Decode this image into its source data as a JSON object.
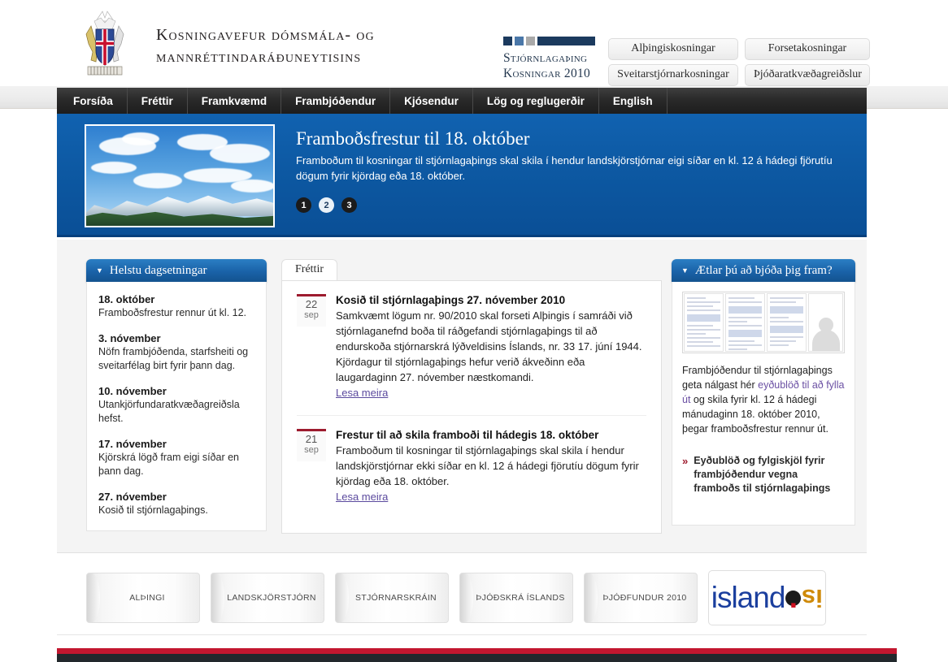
{
  "masthead": {
    "crest_alt": "iceland-coat-of-arms",
    "title_line1": "Kosningavefur dómsmála- og",
    "title_line2": "mannréttindaráðuneytisins",
    "logo": {
      "line1": "Stjórnlagaþing",
      "line2": "Kosningar 2010"
    },
    "buttons": [
      "Alþingiskosningar",
      "Forsetakosningar",
      "Sveitarstjórnarkosningar",
      "Þjóðaratkvæðagreiðslur"
    ]
  },
  "nav": {
    "items": [
      "Forsíða",
      "Fréttir",
      "Framkvæmd",
      "Frambjóðendur",
      "Kjósendur",
      "Lög og reglugerðir",
      "English"
    ]
  },
  "hero": {
    "heading": "Framboðsfrestur til 18. október",
    "paragraph": "Framboðum til kosningar til stjórnlagaþings skal skila í hendur landskjörstjórnar eigi síðar en kl. 12 á hádegi fjörutíu dögum fyrir kjördag eða 18. október.",
    "slides": [
      "1",
      "2",
      "3"
    ],
    "active_slide": "2",
    "image_alt": "iceland-mountain-landscape-photo"
  },
  "dates_panel": {
    "title": "Helstu dagsetningar",
    "items": [
      {
        "date": "18. október",
        "desc": "Framboðsfrestur rennur út kl. 12."
      },
      {
        "date": "3. nóvember",
        "desc": "Nöfn frambjóðenda, starfsheiti og sveitarfélag birt fyrir þann dag."
      },
      {
        "date": "10. nóvember",
        "desc": "Utankjörfundaratkvæðagreiðsla hefst."
      },
      {
        "date": "17. nóvember",
        "desc": "Kjörskrá lögð fram eigi síðar en þann dag."
      },
      {
        "date": "27. nóvember",
        "desc": "Kosið til stjórnlagaþings."
      }
    ]
  },
  "news": {
    "tab_label": "Fréttir",
    "items": [
      {
        "day": "22",
        "month": "sep",
        "headline": "Kosið til stjórnlagaþings 27. nóvember 2010",
        "body": "Samkvæmt lögum nr. 90/2010 skal forseti Alþingis í samráði við stjórnlaganefnd boða til ráðgefandi stjórnlagaþings til að endurskoða stjórnarskrá lýðveldisins Íslands, nr. 33 17. júní 1944. Kjördagur til stjórnlagaþings hefur verið ákveðinn eða laugardaginn 27. nóvember næstkomandi.",
        "more": "Lesa meira"
      },
      {
        "day": "21",
        "month": "sep",
        "headline": "Frestur til að skila framboði til hádegis 18. október",
        "body": "Framboðum til kosningar til stjórnlagaþings skal skila í hendur landskjörstjórnar ekki síðar en kl. 12 á hádegi fjörutíu dögum fyrir kjördag eða 18. október.",
        "more": "Lesa meira"
      }
    ]
  },
  "offer_panel": {
    "title": "Ætlar þú að bjóða þig fram?",
    "thumb_alt": "candidacy-forms-thumbnail",
    "text_before": "Frambjóðendur til stjórnlagaþings geta nálgast hér ",
    "link_text": "eyðublöð til að fylla út",
    "text_after": " og skila fyrir kl. 12 á hádegi mánudaginn 18. október 2010, þegar framboðsfrestur rennur út.",
    "bullet_marker": "»",
    "bullet_link": "Eyðublöð og fylgiskjöl fyrir frambjóðendur vegna framboðs til stjórnlagaþings"
  },
  "partners": {
    "items": [
      "ALÞINGI",
      "LANDSKJÖRSTJÓRN",
      "STJÓRNARSKRÁIN",
      "ÞJÓÐSKRÁ ÍSLANDS",
      "ÞJÓÐFUNDUR 2010"
    ],
    "island_logo": {
      "name": "island",
      "dot": ".",
      "suffix": "is"
    }
  },
  "colors": {
    "nav_bar": "#1d1d1d",
    "hero_blue": "#0d59a3",
    "panel_blue": "#1a62a8",
    "accent_red": "#9d1b2e",
    "footer_red": "#c2172f",
    "footer_dark": "#22282c",
    "link_purple": "#5b4a9e"
  }
}
